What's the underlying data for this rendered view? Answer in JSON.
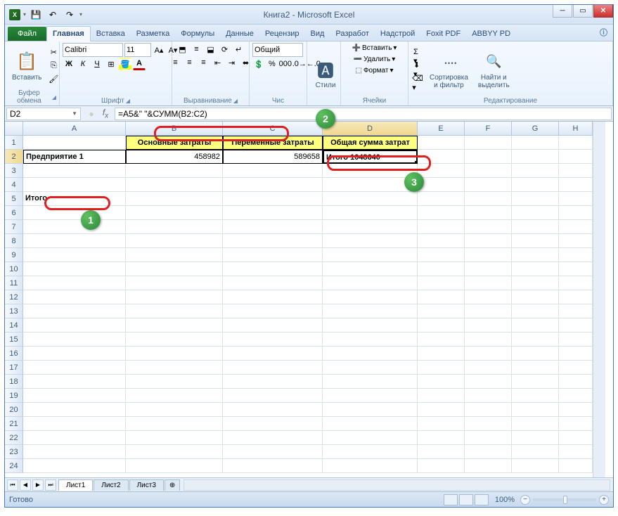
{
  "title": "Книга2 - Microsoft Excel",
  "qat": {
    "save": "💾",
    "undo": "↶",
    "redo": "↷"
  },
  "tabs": {
    "file": "Файл",
    "items": [
      "Главная",
      "Вставка",
      "Разметка",
      "Формулы",
      "Данные",
      "Рецензир",
      "Вид",
      "Разработ",
      "Надстрой",
      "Foxit PDF",
      "ABBYY PD"
    ],
    "active": 0
  },
  "ribbon": {
    "clipboard": {
      "paste": "Вставить",
      "label": "Буфер обмена"
    },
    "font": {
      "name": "Calibri",
      "size": "11",
      "label": "Шрифт"
    },
    "align": {
      "label": "Выравнивание"
    },
    "number": {
      "format": "Общий",
      "label": "Чис"
    },
    "styles": {
      "btn": "Стили",
      "label": ""
    },
    "cells": {
      "insert": "Вставить",
      "delete": "Удалить",
      "format": "Формат",
      "label": "Ячейки"
    },
    "editing": {
      "sort": "Сортировка\nи фильтр",
      "find": "Найти и\nвыделить",
      "label": "Редактирование"
    }
  },
  "fxbar": {
    "name": "D2",
    "formula": "=A5&\" \"&СУММ(B2:C2)"
  },
  "columns": [
    "A",
    "B",
    "C",
    "D",
    "E",
    "F",
    "G",
    "H"
  ],
  "headers": {
    "b1": "Основные затраты",
    "c1": "Переменные затраты",
    "d1": "Общая сумма затрат"
  },
  "row2": {
    "a": "Предприятие 1",
    "b": "458982",
    "c": "589658",
    "d": "Итого 1048640"
  },
  "row5": {
    "a": "Итого"
  },
  "sheets": {
    "s1": "Лист1",
    "s2": "Лист2",
    "s3": "Лист3"
  },
  "status": {
    "ready": "Готово",
    "zoom": "100%"
  },
  "callouts": {
    "n1": "1",
    "n2": "2",
    "n3": "3"
  }
}
